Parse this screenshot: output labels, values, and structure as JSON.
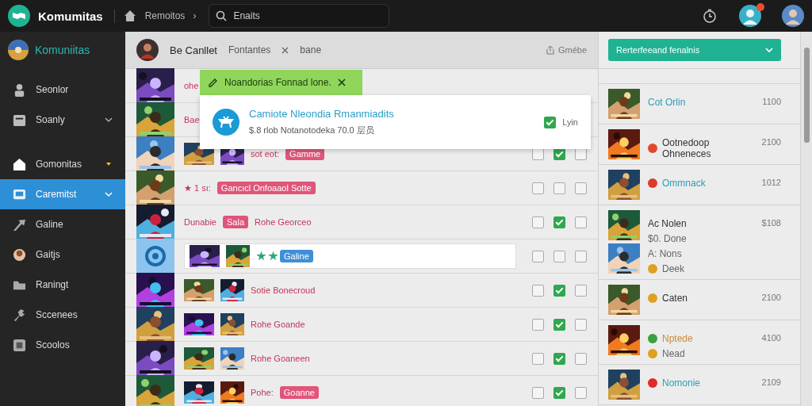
{
  "topbar": {
    "brand": "Komumitas",
    "breadcrumb": "Remoitos",
    "separator": "›",
    "search": {
      "value": "Enaits"
    }
  },
  "sidebar": {
    "profile": "Komuniitas",
    "groups": [
      [
        {
          "label": "Seonlor",
          "kind": "plain",
          "selected": false
        },
        {
          "label": "Soanly",
          "kind": "dropdown",
          "selected": false
        }
      ],
      [
        {
          "label": "Gomonitas",
          "kind": "caret",
          "selected": false
        },
        {
          "label": "Caremitst",
          "kind": "dropdown",
          "selected": true
        },
        {
          "label": "Galine",
          "kind": "plain",
          "selected": false
        },
        {
          "label": "Gaitjs",
          "kind": "plain",
          "selected": false
        },
        {
          "label": "Raningt",
          "kind": "plain",
          "selected": false
        },
        {
          "label": "Sccenees",
          "kind": "plain",
          "selected": false
        },
        {
          "label": "Scoolos",
          "kind": "plain",
          "selected": false
        }
      ]
    ]
  },
  "header": {
    "name": "Be Canllet",
    "tab": "Fontantes",
    "filter": "bane",
    "action": "Gmébe"
  },
  "rows": [
    {
      "kind": "picture",
      "selected": false,
      "parts": [
        {
          "kind": "text",
          "text": "ohe"
        }
      ]
    },
    {
      "kind": "picture",
      "selected": false,
      "parts": [
        {
          "kind": "text",
          "text": "Bae"
        }
      ]
    },
    {
      "kind": "picture",
      "selected": false,
      "parts": [
        {
          "kind": "picture"
        },
        {
          "kind": "picture"
        },
        {
          "kind": "text",
          "text": "sot eot:"
        },
        {
          "kind": "tag",
          "text": "Gamme",
          "color": "#e0557a"
        }
      ],
      "checks": [
        {
          "checked": false
        },
        {
          "checked": true
        },
        {
          "checked": false
        }
      ]
    },
    {
      "kind": "picture",
      "selected": false,
      "parts": [
        {
          "kind": "text",
          "text": "★ 1 sı:"
        },
        {
          "kind": "tag",
          "text": "Gancıcl Onfoaaol Sotte",
          "color": "#e0557a"
        }
      ],
      "checks": [
        {
          "checked": false
        },
        {
          "checked": false
        },
        {
          "checked": false
        }
      ]
    },
    {
      "kind": "picture",
      "selected": false,
      "parts": [
        {
          "kind": "text",
          "text": "Dunabie"
        },
        {
          "kind": "tag",
          "text": "Sala",
          "color": "#e0557a"
        },
        {
          "kind": "text",
          "text": "Rohe Georceo"
        }
      ],
      "checks": [
        {
          "checked": false
        },
        {
          "checked": true
        },
        {
          "checked": false
        }
      ]
    },
    {
      "kind": "icon",
      "selected": true,
      "parts": [
        {
          "kind": "picture"
        },
        {
          "kind": "picture"
        },
        {
          "kind": "star"
        },
        {
          "kind": "star"
        },
        {
          "kind": "tag",
          "text": "Galine",
          "color": "#3f8fd8"
        }
      ],
      "checks": [
        {
          "checked": false
        },
        {
          "checked": false
        },
        {
          "checked": false
        }
      ]
    },
    {
      "kind": "picture",
      "selected": false,
      "parts": [
        {
          "kind": "picture"
        },
        {
          "kind": "picture"
        },
        {
          "kind": "text",
          "text": "Sotie Bonecroud"
        }
      ],
      "checks": [
        {
          "checked": false
        },
        {
          "checked": true
        },
        {
          "checked": false
        }
      ]
    },
    {
      "kind": "picture",
      "selected": false,
      "parts": [
        {
          "kind": "picture"
        },
        {
          "kind": "picture"
        },
        {
          "kind": "text",
          "text": "Rohe Goande"
        }
      ],
      "checks": [
        {
          "checked": false
        },
        {
          "checked": true
        },
        {
          "checked": false
        }
      ]
    },
    {
      "kind": "picture",
      "selected": false,
      "parts": [
        {
          "kind": "picture"
        },
        {
          "kind": "picture"
        },
        {
          "kind": "text",
          "text": "Rohe Goaneen"
        }
      ],
      "checks": [
        {
          "checked": false
        },
        {
          "checked": true
        },
        {
          "checked": false
        }
      ]
    },
    {
      "kind": "picture",
      "selected": false,
      "parts": [
        {
          "kind": "picture"
        },
        {
          "kind": "picture"
        },
        {
          "kind": "text",
          "text": "Pohe:"
        },
        {
          "kind": "tag",
          "text": "Goanne",
          "color": "#e0557a"
        }
      ],
      "checks": [
        {
          "checked": false
        },
        {
          "checked": true
        },
        {
          "checked": false
        }
      ]
    }
  ],
  "toast": {
    "message": "Noandorias Fonnad lone.",
    "card": {
      "title": "Camiote Nleondia Rmanmiadits",
      "subtitle": "$.8 rlob Notanotodeka 70.0 层员",
      "check": {
        "label": "Lyin",
        "checked": true
      }
    }
  },
  "panel": {
    "dropdown": "Rerterfeeand fenalnis",
    "items": [
      {
        "pictures": [
          {
            "kind": "picture"
          }
        ],
        "value": "1100",
        "lines": [
          {
            "text": "Cot Orlin",
            "color": "#2a9fb8"
          }
        ]
      },
      {
        "pictures": [
          {
            "kind": "picture"
          }
        ],
        "value": "2100",
        "lines": [
          {
            "text": "Ootnedoop Ohneneces",
            "color": "#333333",
            "dot": {
              "color": "#e04a2a"
            }
          }
        ]
      },
      {
        "pictures": [
          {
            "kind": "picture"
          }
        ],
        "value": "1012",
        "lines": [
          {
            "text": "Ommnack",
            "color": "#2a9fb8",
            "dot": {
              "color": "#e03a2a"
            }
          }
        ]
      },
      {
        "pictures": [
          {
            "kind": "picture"
          },
          {
            "kind": "picture"
          }
        ],
        "value": "$108",
        "lines": [
          {
            "text": "Ac Nolen",
            "color": "#333333"
          },
          {
            "text": "$0. Done",
            "color": "#666666"
          },
          {
            "text": "A: Nons",
            "color": "#666666"
          },
          {
            "text": "Deek",
            "color": "#666666",
            "dot": {
              "color": "#e0a020"
            }
          }
        ]
      },
      {
        "pictures": [
          {
            "kind": "picture"
          }
        ],
        "value": "2100",
        "lines": [
          {
            "text": "Caten",
            "color": "#333333",
            "dot": {
              "color": "#e0a020"
            }
          }
        ]
      },
      {
        "pictures": [
          {
            "kind": "picture"
          }
        ],
        "value": "4100",
        "lines": [
          {
            "text": "Nptede",
            "color": "#d08a30",
            "dot": {
              "color": "#3aa040"
            }
          },
          {
            "text": "Nead",
            "color": "#666666",
            "dot": {
              "color": "#e0a020"
            }
          }
        ]
      },
      {
        "pictures": [
          {
            "kind": "picture"
          }
        ],
        "value": "2109",
        "lines": [
          {
            "text": "Nomonie",
            "color": "#2a9fb8",
            "dot": {
              "color": "#e02a2a"
            }
          }
        ]
      }
    ]
  }
}
